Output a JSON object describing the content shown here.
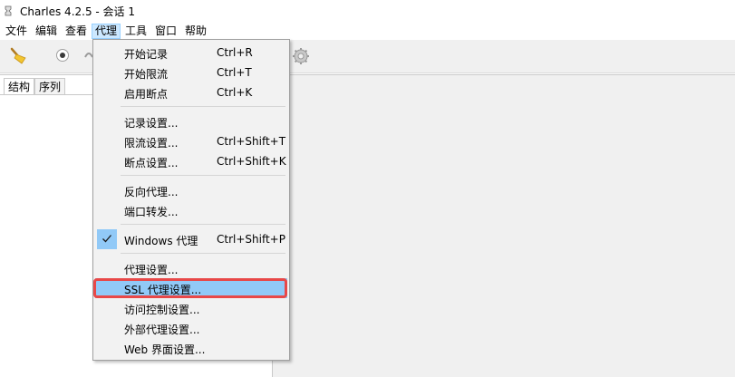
{
  "window": {
    "title": "Charles 4.2.5 - 会话 1"
  },
  "menubar": {
    "items": [
      "文件",
      "编辑",
      "查看",
      "代理",
      "工具",
      "窗口",
      "帮助"
    ],
    "active": "代理"
  },
  "tabs": [
    "结构",
    "序列"
  ],
  "proxy_menu": {
    "items": [
      {
        "label": "开始记录",
        "shortcut": "Ctrl+R"
      },
      {
        "label": "开始限流",
        "shortcut": "Ctrl+T"
      },
      {
        "label": "启用断点",
        "shortcut": "Ctrl+K"
      },
      {
        "label": "记录设置...",
        "shortcut": ""
      },
      {
        "label": "限流设置...",
        "shortcut": "Ctrl+Shift+T"
      },
      {
        "label": "断点设置...",
        "shortcut": "Ctrl+Shift+K"
      },
      {
        "label": "反向代理...",
        "shortcut": ""
      },
      {
        "label": "端口转发...",
        "shortcut": ""
      },
      {
        "label": "Windows 代理",
        "shortcut": "Ctrl+Shift+P",
        "checked": true
      },
      {
        "label": "代理设置...",
        "shortcut": ""
      },
      {
        "label": "SSL 代理设置...",
        "shortcut": "",
        "hovered": true
      },
      {
        "label": "访问控制设置...",
        "shortcut": ""
      },
      {
        "label": "外部代理设置...",
        "shortcut": ""
      },
      {
        "label": "Web 界面设置...",
        "shortcut": ""
      }
    ]
  },
  "colors": {
    "menu_hover": "#91c9f7",
    "menubar_active": "#cce8ff",
    "annotation_box": "#e84848"
  },
  "icons": [
    "app-icon",
    "broom-icon",
    "record-icon",
    "throttle-icon",
    "settings-icon",
    "check-icon"
  ]
}
